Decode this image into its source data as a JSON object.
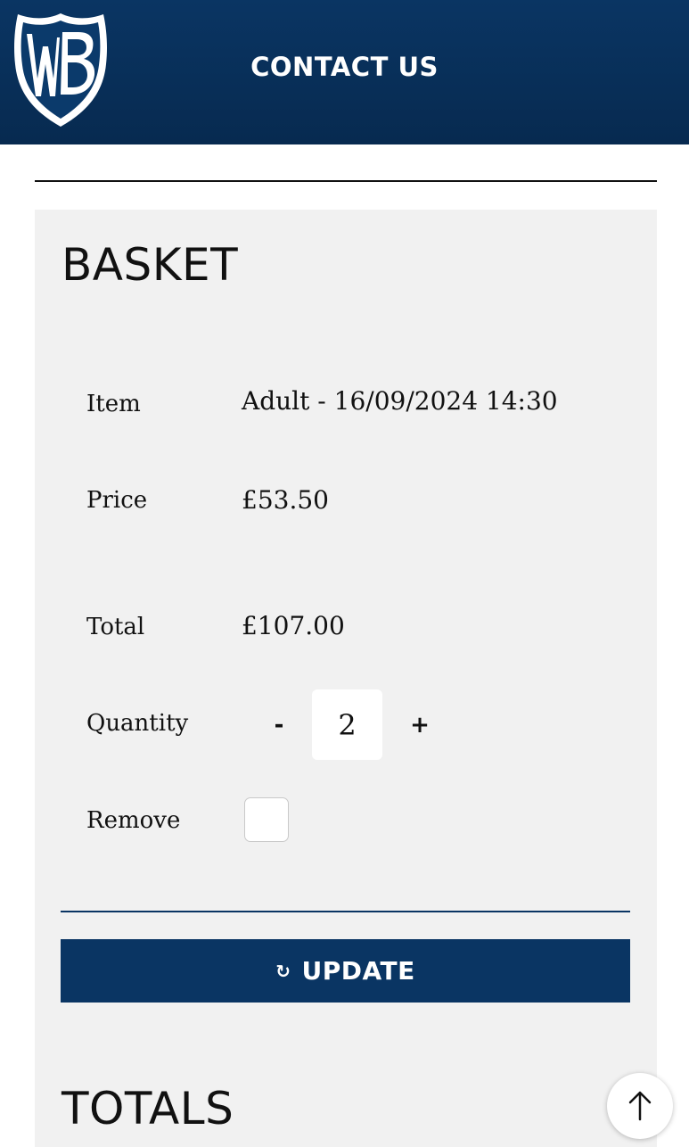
{
  "header": {
    "logo_text": "WB",
    "title": "CONTACT US"
  },
  "basket": {
    "title": "BASKET",
    "rows": [
      {
        "label": "Item",
        "value": "Adult - 16/09/2024 14:30"
      },
      {
        "label": "Price",
        "value": "£53.50"
      },
      {
        "label": "Total",
        "value": "£107.00"
      }
    ],
    "quantity": {
      "label": "Quantity",
      "minus": "-",
      "value": "2",
      "plus": "+"
    },
    "remove": {
      "label": "Remove",
      "checked": false
    },
    "update_button": "UPDATE",
    "update_icon": "refresh-icon"
  },
  "totals": {
    "title": "TOTALS"
  },
  "scroll_top_icon": "arrow-up-icon",
  "colors": {
    "brand": "#0a3563",
    "panel": "#f1f1f1"
  }
}
